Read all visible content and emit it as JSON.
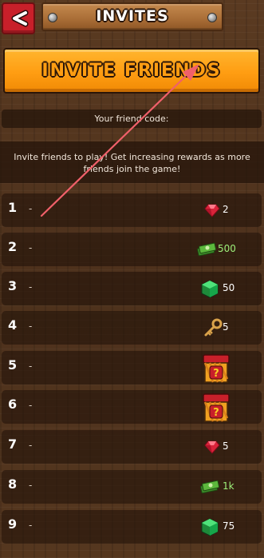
{
  "header": {
    "title": "INVITES",
    "back_icon": "chevron-left-icon"
  },
  "invite_button": {
    "label": "INVITE FRIENDS"
  },
  "friend_code": {
    "label": "Your friend code:"
  },
  "info": {
    "text": "Invite friends to play! Get increasing rewards as more friends join the game!"
  },
  "rewards": [
    {
      "num": "1",
      "dash": "-",
      "icon": "ruby-icon",
      "amount": "2"
    },
    {
      "num": "2",
      "dash": "-",
      "icon": "cash-stack-icon",
      "amount": "500"
    },
    {
      "num": "3",
      "dash": "-",
      "icon": "green-cube-icon",
      "amount": "50"
    },
    {
      "num": "4",
      "dash": "-",
      "icon": "key-icon",
      "amount": "5"
    },
    {
      "num": "5",
      "dash": "-",
      "icon": "mystery-chest-icon",
      "amount": ""
    },
    {
      "num": "6",
      "dash": "-",
      "icon": "mystery-chest-icon",
      "amount": ""
    },
    {
      "num": "7",
      "dash": "-",
      "icon": "ruby-icon",
      "amount": "5"
    },
    {
      "num": "8",
      "dash": "-",
      "icon": "cash-stack-icon",
      "amount": "1k"
    },
    {
      "num": "9",
      "dash": "-",
      "icon": "green-cube-icon",
      "amount": "75"
    }
  ],
  "colors": {
    "accent_orange": "#ff9d12",
    "back_red": "#c8202a",
    "annotation_arrow": "#f0606a",
    "cash_green": "#9ef07a"
  }
}
